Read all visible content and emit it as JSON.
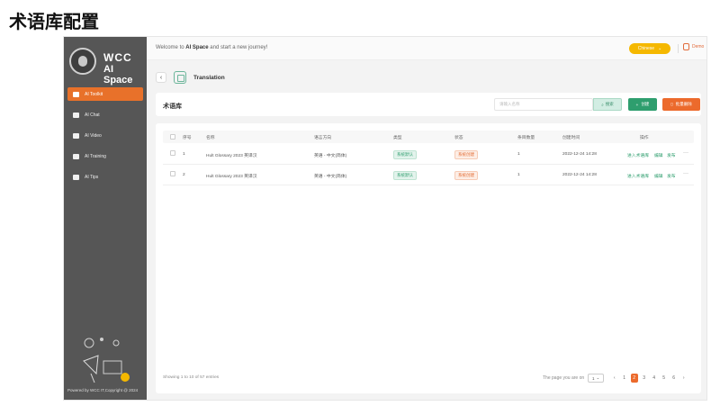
{
  "slide_title": "术语库配置",
  "sidebar": {
    "logo_line1": "WCC",
    "logo_line2": "AI Space",
    "items": [
      {
        "label": "AI Toolkit",
        "icon": "toolkit-icon",
        "active": true
      },
      {
        "label": "AI Chat",
        "icon": "chat-icon",
        "active": false
      },
      {
        "label": "AI Video",
        "icon": "video-icon",
        "active": false
      },
      {
        "label": "AI Training",
        "icon": "training-icon",
        "active": false
      },
      {
        "label": "AI Tips",
        "icon": "tips-icon",
        "active": false
      }
    ],
    "footer": "Powered by WCC IT,Copyright @ 2024"
  },
  "topbar": {
    "welcome_prefix": "Welcome to",
    "welcome_brand": "AI Space",
    "welcome_suffix": "and start a new journey!",
    "language": "Chinese",
    "user": "Demo"
  },
  "breadcrumb": {
    "back": "‹",
    "title": "Translation"
  },
  "toolbar": {
    "heading": "术语库",
    "search_placeholder": "请输入名称",
    "search_label": "搜索",
    "create_label": "创建",
    "bulk_delete_label": "批量删除"
  },
  "table": {
    "headers": [
      "序号",
      "名称",
      "语言方向",
      "类型",
      "状态",
      "条目数量",
      "创建时间",
      "操作"
    ],
    "rows": [
      {
        "index": "1",
        "name": "Hult Glossary 2023 英译汉",
        "direction": "英语 - 中文(简体)",
        "type": "系统默认",
        "status": "系统创建",
        "count": "1",
        "created": "2022-12-24 14:28",
        "actions": [
          "进入术语库",
          "编辑",
          "发布"
        ]
      },
      {
        "index": "2",
        "name": "Hult Glossary 2023 英译汉",
        "direction": "英语 - 中文(简体)",
        "type": "系统默认",
        "status": "系统创建",
        "count": "1",
        "created": "2022-12-24 14:28",
        "actions": [
          "进入术语库",
          "编辑",
          "发布"
        ]
      }
    ]
  },
  "pagination": {
    "showing": "Showing 1 to 10 of 57 entries",
    "page_label": "The page you are on",
    "page_select": "1",
    "prev": "‹",
    "pages": [
      "1",
      "2",
      "3",
      "4",
      "5",
      "6"
    ],
    "active_page": "2",
    "next": "›"
  },
  "colors": {
    "accent": "#e8712a",
    "green": "#2e9e6e",
    "lang_button": "#f5b800",
    "sidebar": "#565656"
  }
}
